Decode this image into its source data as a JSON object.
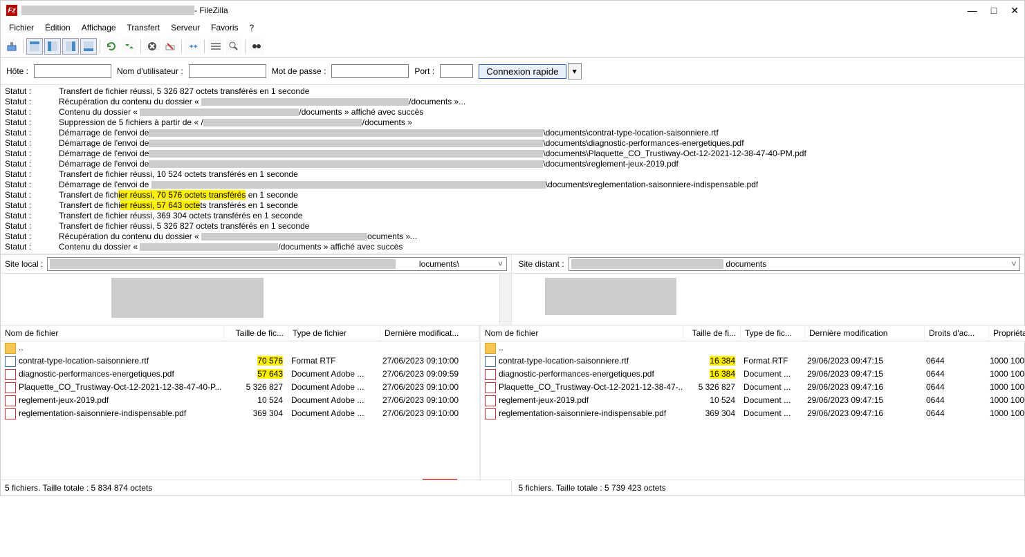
{
  "window": {
    "title_suffix": " - FileZilla"
  },
  "wincontrols": {
    "min": "—",
    "max": "□",
    "close": "✕"
  },
  "menu": [
    "Fichier",
    "Édition",
    "Affichage",
    "Transfert",
    "Serveur",
    "Favoris",
    "?"
  ],
  "quickconnect": {
    "host_label": "Hôte :",
    "user_label": "Nom d'utilisateur :",
    "pass_label": "Mot de passe :",
    "port_label": "Port :",
    "connect_label": "Connexion rapide",
    "host": "",
    "user": "",
    "pass": "",
    "port": ""
  },
  "log_label": "Statut :",
  "log": [
    {
      "t": "Transfert de fichier réussi, 5 326 827 octets transférés en 1 seconde"
    },
    {
      "pre": "Récupération du contenu du dossier « ",
      "redact": 300,
      "post": "/documents »..."
    },
    {
      "pre": "Contenu du dossier « ",
      "redact": 230,
      "post": "/documents » affiché avec succès"
    },
    {
      "pre": "Suppression de 5 fichiers à partir de « /",
      "redact": 230,
      "post": "/documents »"
    },
    {
      "pre": "Démarrage de l'envoi de",
      "redact": 570,
      "post": "\\documents\\contrat-type-location-saisonniere.rtf"
    },
    {
      "pre": "Démarrage de l'envoi de",
      "redact": 570,
      "post": "\\documents\\diagnostic-performances-energetiques.pdf"
    },
    {
      "pre": "Démarrage de l'envoi de",
      "redact": 570,
      "post": "\\documents\\Plaquette_CO_Trustiway-Oct-12-2021-12-38-47-40-PM.pdf"
    },
    {
      "pre": "Démarrage de l'envoi de",
      "redact": 570,
      "post": "\\documents\\reglement-jeux-2019.pdf"
    },
    {
      "t": "Transfert de fichier réussi, 10 524 octets transférés en 1 seconde"
    },
    {
      "pre": "Démarrage de l'envoi de ",
      "redact": 570,
      "post": "\\documents\\reglementation-saisonniere-indispensable.pdf"
    },
    {
      "seg": [
        {
          "t": "Transfert de fich"
        },
        {
          "t": "ier réussi, 70 576 octets transférés",
          "hl": true
        },
        {
          "t": " en 1 seconde"
        }
      ]
    },
    {
      "seg": [
        {
          "t": "Transfert de fichi"
        },
        {
          "t": "er réussi, 57 643 octe",
          "hl": true
        },
        {
          "t": "ts transférés en 1 seconde"
        }
      ]
    },
    {
      "t": "Transfert de fichier réussi, 369 304 octets transférés en 1 seconde"
    },
    {
      "t": "Transfert de fichier réussi, 5 326 827 octets transférés en 1 seconde"
    },
    {
      "pre": "Récupération du contenu du dossier « ",
      "redact": 240,
      "post": "ocuments »..."
    },
    {
      "pre": "Contenu du dossier « ",
      "redact": 200,
      "post": "/documents » affiché avec succès"
    }
  ],
  "sites": {
    "local_label": "Site local :",
    "local_path_suffix": "locuments\\",
    "remote_label": "Site distant :",
    "remote_path_suffix": "documents"
  },
  "local": {
    "cols": {
      "name": "Nom de fichier",
      "size": "Taille de fic...",
      "type": "Type de fichier",
      "date": "Dernière modificat..."
    },
    "up": "..",
    "files": [
      {
        "ico": "rtf",
        "name": "contrat-type-location-saisonniere.rtf",
        "size": "70 576",
        "size_hl": true,
        "type": "Format RTF",
        "date": "27/06/2023 09:10:00"
      },
      {
        "ico": "pdf",
        "name": "diagnostic-performances-energetiques.pdf",
        "size": "57 643",
        "size_hl": true,
        "type": "Document Adobe ...",
        "date": "27/06/2023 09:09:59"
      },
      {
        "ico": "pdf",
        "name": "Plaquette_CO_Trustiway-Oct-12-2021-12-38-47-40-P...",
        "size": "5 326 827",
        "type": "Document Adobe ...",
        "date": "27/06/2023 09:10:00"
      },
      {
        "ico": "pdf",
        "name": "reglement-jeux-2019.pdf",
        "size": "10 524",
        "type": "Document Adobe ...",
        "date": "27/06/2023 09:10:00"
      },
      {
        "ico": "pdf",
        "name": "reglementation-saisonniere-indispensable.pdf",
        "size": "369 304",
        "type": "Document Adobe ...",
        "date": "27/06/2023 09:10:00"
      }
    ],
    "status": "5 fichiers. Taille totale : 5 834 874 octets"
  },
  "remote": {
    "cols": {
      "name": "Nom de fichier",
      "size": "Taille de fi...",
      "type": "Type de fic...",
      "date": "Dernière modification",
      "perm": "Droits d'ac...",
      "own": "Propriétaire..."
    },
    "up": "..",
    "files": [
      {
        "ico": "rtf",
        "name": "contrat-type-location-saisonniere.rtf",
        "size": "16 384",
        "size_hl": true,
        "type": "Format RTF",
        "date": "29/06/2023 09:47:15",
        "perm": "0644",
        "own": "1000 100"
      },
      {
        "ico": "pdf",
        "name": "diagnostic-performances-energetiques.pdf",
        "size": "16 384",
        "size_hl": true,
        "type": "Document ...",
        "date": "29/06/2023 09:47:15",
        "perm": "0644",
        "own": "1000 100"
      },
      {
        "ico": "pdf",
        "name": "Plaquette_CO_Trustiway-Oct-12-2021-12-38-47-...",
        "size": "5 326 827",
        "type": "Document ...",
        "date": "29/06/2023 09:47:16",
        "perm": "0644",
        "own": "1000 100"
      },
      {
        "ico": "pdf",
        "name": "reglement-jeux-2019.pdf",
        "size": "10 524",
        "type": "Document ...",
        "date": "29/06/2023 09:47:15",
        "perm": "0644",
        "own": "1000 100"
      },
      {
        "ico": "pdf",
        "name": "reglementation-saisonniere-indispensable.pdf",
        "size": "369 304",
        "type": "Document ...",
        "date": "29/06/2023 09:47:16",
        "perm": "0644",
        "own": "1000 100"
      }
    ],
    "status": "5 fichiers. Taille totale : 5 739 423 octets"
  }
}
